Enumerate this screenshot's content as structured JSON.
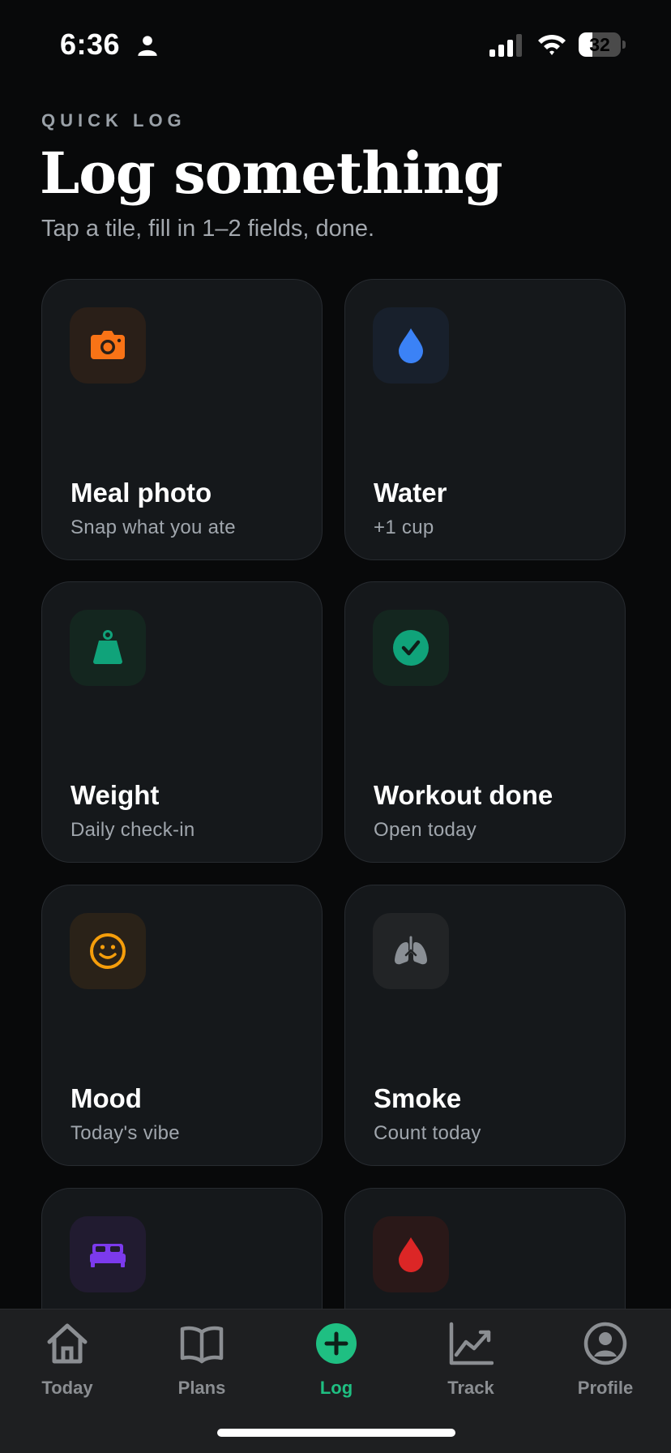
{
  "status_bar": {
    "time": "6:36",
    "battery_level": "32",
    "battery_fraction": 0.32
  },
  "header": {
    "eyebrow": "QUICK LOG",
    "title": "Log something",
    "subtitle": "Tap a tile, fill in 1–2 fields, done."
  },
  "tiles": [
    {
      "title": "Meal photo",
      "subtitle": "Snap what you ate",
      "icon": "camera-icon",
      "accent": "#f97316",
      "icon_bg": "#2a1f18"
    },
    {
      "title": "Water",
      "subtitle": "+1 cup",
      "icon": "water-drop-icon",
      "accent": "#3b82f6",
      "icon_bg": "#18202c"
    },
    {
      "title": "Weight",
      "subtitle": "Daily check-in",
      "icon": "weight-icon",
      "accent": "#10a37a",
      "icon_bg": "#14261f"
    },
    {
      "title": "Workout done",
      "subtitle": "Open today",
      "icon": "check-circle-icon",
      "accent": "#10a37a",
      "icon_bg": "#14261f"
    },
    {
      "title": "Mood",
      "subtitle": "Today's vibe",
      "icon": "smiley-icon",
      "accent": "#f59e0b",
      "icon_bg": "#2a2218"
    },
    {
      "title": "Smoke",
      "subtitle": "Count today",
      "icon": "lungs-icon",
      "accent": "#8a8f95",
      "icon_bg": "#222426"
    },
    {
      "title": "",
      "subtitle": "",
      "icon": "bed-icon",
      "accent": "#7c3aed",
      "icon_bg": "#211b30"
    },
    {
      "title": "",
      "subtitle": "",
      "icon": "blood-drop-icon",
      "accent": "#dc2626",
      "icon_bg": "#2a1818"
    }
  ],
  "tab_bar": {
    "tabs": [
      {
        "label": "Today",
        "icon": "home-icon",
        "active": false
      },
      {
        "label": "Plans",
        "icon": "book-icon",
        "active": false
      },
      {
        "label": "Log",
        "icon": "plus-circle-icon",
        "active": true
      },
      {
        "label": "Track",
        "icon": "chart-icon",
        "active": false
      },
      {
        "label": "Profile",
        "icon": "profile-icon",
        "active": false
      }
    ],
    "active_color": "#1fbf82",
    "inactive_color": "#8b8e92"
  }
}
